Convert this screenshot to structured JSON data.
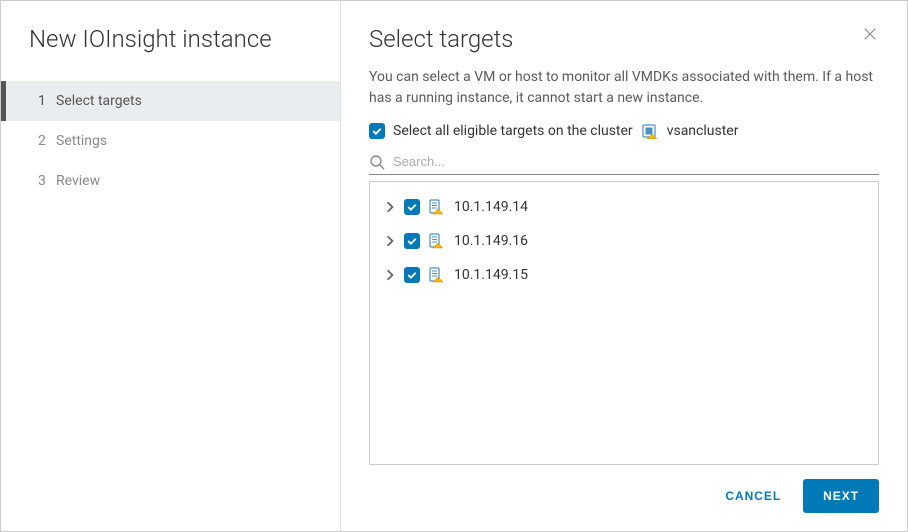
{
  "wizard": {
    "title": "New IOInsight instance",
    "steps": [
      {
        "num": "1",
        "label": "Select targets",
        "active": true
      },
      {
        "num": "2",
        "label": "Settings",
        "active": false
      },
      {
        "num": "3",
        "label": "Review",
        "active": false
      }
    ]
  },
  "page": {
    "title": "Select targets",
    "description": "You can select a VM or host to monitor all VMDKs associated with them. If a host has a running instance, it cannot start a new instance.",
    "select_all_prefix": "Select all eligible targets on the cluster",
    "cluster_name": "vsancluster",
    "select_all_checked": true
  },
  "search": {
    "placeholder": "Search..."
  },
  "targets": [
    {
      "label": "10.1.149.14",
      "checked": true
    },
    {
      "label": "10.1.149.16",
      "checked": true
    },
    {
      "label": "10.1.149.15",
      "checked": true
    }
  ],
  "actions": {
    "cancel": "CANCEL",
    "next": "NEXT"
  }
}
